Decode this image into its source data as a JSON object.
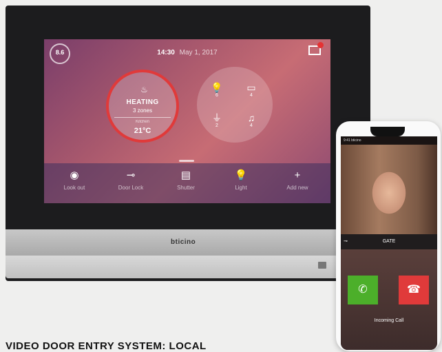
{
  "brand": "bticino",
  "screen": {
    "clock_value": "8.6",
    "time": "14:30",
    "date": "May 1, 2017",
    "mail_icon": "mail-icon",
    "heating": {
      "icon": "flame-icon",
      "title": "HEATING",
      "zones": "3 zones",
      "room_label": "Kitchen",
      "temperature": "21°C"
    },
    "devices": [
      {
        "icon": "light-bulb-icon",
        "glyph": "💡",
        "count": "6"
      },
      {
        "icon": "shutter-icon",
        "glyph": "▭",
        "count": "4"
      },
      {
        "icon": "plug-icon",
        "glyph": "⏚",
        "count": "2"
      },
      {
        "icon": "music-icon",
        "glyph": "♫",
        "count": "4"
      }
    ],
    "nav": [
      {
        "label": "Look out",
        "icon": "eye-icon",
        "glyph": "◉"
      },
      {
        "label": "Door Lock",
        "icon": "key-icon",
        "glyph": "⊸"
      },
      {
        "label": "Shutter",
        "icon": "shutter-icon",
        "glyph": "▤"
      },
      {
        "label": "Light",
        "icon": "light-bulb-icon",
        "glyph": "💡"
      },
      {
        "label": "Add new",
        "icon": "plus-icon",
        "glyph": "+"
      }
    ]
  },
  "phone": {
    "status_text": "9:41  bticino",
    "gate_label": "GATE",
    "key_glyph": "⊸",
    "accept_icon": "phone-accept-icon",
    "accept_glyph": "✆",
    "decline_icon": "phone-decline-icon",
    "decline_glyph": "☎",
    "incoming_label": "Incoming Call"
  },
  "caption": "VIDEO DOOR ENTRY SYSTEM: LOCAL"
}
